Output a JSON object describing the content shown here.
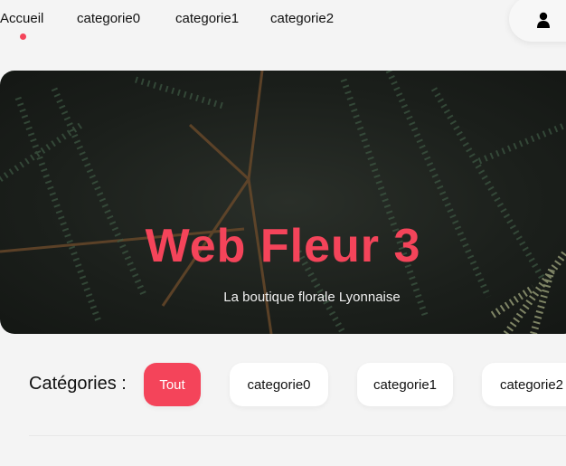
{
  "nav": {
    "items": [
      {
        "label": "Accueil",
        "active": true
      },
      {
        "label": "categorie0"
      },
      {
        "label": "categorie1"
      },
      {
        "label": "categorie2"
      }
    ],
    "user_icon": "user-icon"
  },
  "hero": {
    "title": "Web Fleur 3",
    "subtitle": "La boutique florale Lyonnaise"
  },
  "categories": {
    "label": "Catégories :",
    "chips": [
      {
        "label": "Tout",
        "active": true
      },
      {
        "label": "categorie0"
      },
      {
        "label": "categorie1"
      },
      {
        "label": "categorie2"
      }
    ]
  },
  "colors": {
    "accent": "#f4445a",
    "background": "#f4f4f4"
  }
}
